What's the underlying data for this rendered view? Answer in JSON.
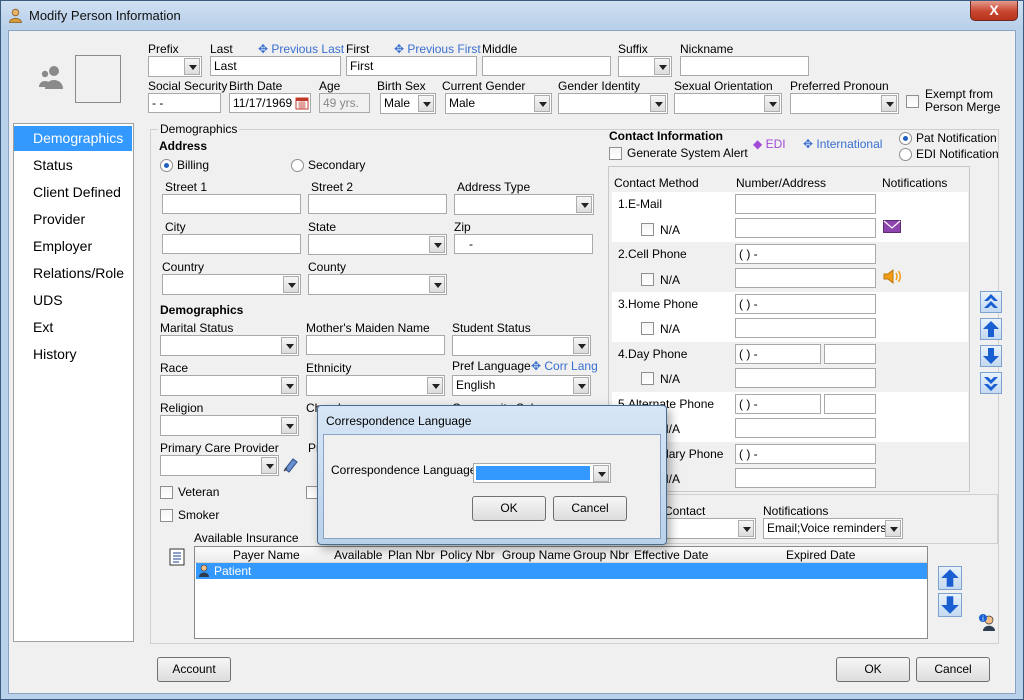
{
  "window": {
    "title": "Modify Person Information",
    "close": "X"
  },
  "name": {
    "prefix_label": "Prefix",
    "last_label": "Last",
    "prev_last": "✥ Previous Last",
    "first_label": "First",
    "prev_first": "✥ Previous First",
    "middle_label": "Middle",
    "suffix_label": "Suffix",
    "nickname_label": "Nickname",
    "last_value": "Last",
    "first_value": "First"
  },
  "personal": {
    "ssn_label": "Social Security",
    "ssn_value": " - -",
    "dob_label": "Birth Date",
    "dob_value": "11/17/1969",
    "age_label": "Age",
    "age_value": "49 yrs.",
    "sex_label": "Birth Sex",
    "sex_value": "Male",
    "gender_label": "Current Gender",
    "gender_value": "Male",
    "identity_label": "Gender Identity",
    "orientation_label": "Sexual Orientation",
    "pronoun_label": "Preferred Pronoun",
    "exempt_label_1": "Exempt from",
    "exempt_label_2": "Person Merge"
  },
  "nav": {
    "items": [
      "Demographics",
      "Status",
      "Client Defined",
      "Provider",
      "Employer",
      "Relations/Role",
      "UDS",
      "Ext",
      "History"
    ]
  },
  "demographics": {
    "section_label": "Demographics",
    "address_label": "Address",
    "billing": "Billing",
    "secondary": "Secondary",
    "street1": "Street 1",
    "street2": "Street 2",
    "address_type": "Address Type",
    "city": "City",
    "state": "State",
    "zip": "Zip",
    "zip_value": "-",
    "country": "Country",
    "county": "County",
    "demo_label": "Demographics",
    "marital": "Marital Status",
    "maiden": "Mother's Maiden Name",
    "student": "Student Status",
    "race": "Race",
    "ethnicity": "Ethnicity",
    "pref_lang": "Pref Language",
    "corr_lang": "✥ Corr Lang",
    "pref_lang_value": "English",
    "religion": "Religion",
    "church_partial": "Church",
    "community_partial": "Community Sub",
    "pcp": "Primary Care Provider",
    "pr_partial": "Pri",
    "veteran": "Veteran",
    "smoker": "Smoker"
  },
  "contact": {
    "title": "Contact Information",
    "edi": "◆ EDI",
    "international": "✥ International",
    "pat_notif": "Pat Notification",
    "edi_notif": "EDI Notification",
    "gen_alert": "Generate System Alert",
    "col_method": "Contact Method",
    "col_number": "Number/Address",
    "col_notif": "Notifications",
    "rows": [
      {
        "label": "1.E-Mail",
        "na": "N/A",
        "value": ""
      },
      {
        "label": "2.Cell Phone",
        "na": "N/A",
        "value": "(   )   -"
      },
      {
        "label": "3.Home Phone",
        "na": "N/A",
        "value": "(   )   -"
      },
      {
        "label": "4.Day Phone",
        "na": "N/A",
        "value": "(   )   -"
      },
      {
        "label": "5.Alternate Phone",
        "na": "N/A",
        "value": "(   )   -"
      },
      {
        "label": "6.Secondary Phone",
        "na": "N/A",
        "value": "(   )   -"
      }
    ],
    "pref_contact_partial": "Contact",
    "notifications_label": "Notifications",
    "notifications_value": "Email;Voice reminders"
  },
  "insurance": {
    "label": "Available Insurance",
    "columns": [
      "Payer Name",
      "Available",
      "Plan Nbr",
      "Policy Nbr",
      "Group Name",
      "Group Nbr",
      "Effective Date",
      "Expired Date"
    ],
    "rows": [
      {
        "payer": "Patient"
      }
    ]
  },
  "dialog": {
    "title": "Correspondence Language",
    "field_label": "Correspondence Language:",
    "ok": "OK",
    "cancel": "Cancel"
  },
  "footer": {
    "account": "Account",
    "ok": "OK",
    "cancel": "Cancel"
  }
}
